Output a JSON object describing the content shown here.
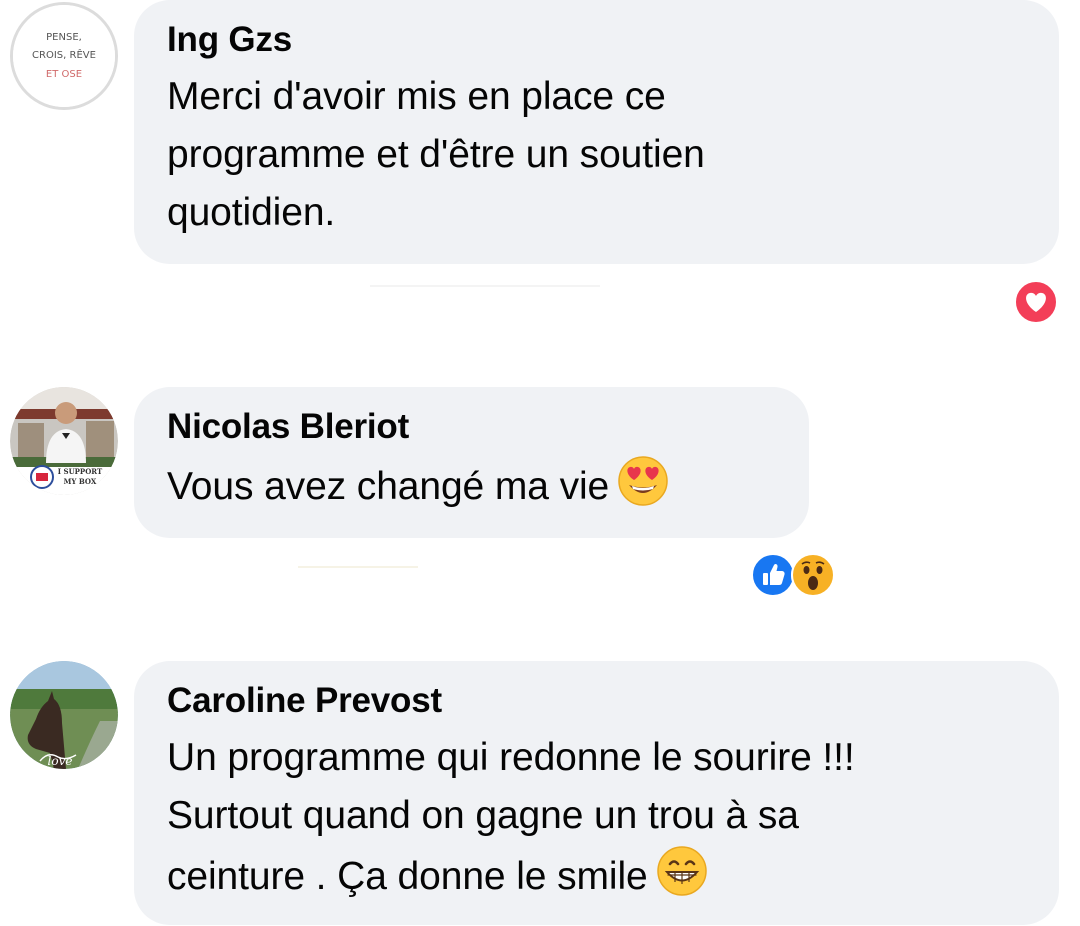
{
  "comments": [
    {
      "author": "Ing Gzs",
      "text_lines": [
        "Merci d'avoir mis en place ce",
        "programme et d'être un soutien",
        "quotidien."
      ],
      "avatar_text": [
        "PENSE,",
        "CROIS, RÊVE",
        "ET OSE"
      ],
      "reactions": [
        "heart-icon"
      ]
    },
    {
      "author": "Nicolas Bleriot",
      "text_lines": [
        "Vous avez changé ma vie"
      ],
      "emoji": "heart-eyes-emoji-icon",
      "avatar_badge_text": [
        "I SUPPORT",
        "MY BOX"
      ],
      "reactions": [
        "like-icon",
        "wow-icon"
      ]
    },
    {
      "author": "Caroline Prevost",
      "text_lines": [
        "Un programme qui redonne le sourire !!!",
        "Surtout quand on gagne un trou à sa",
        "ceinture . Ça donne le smile"
      ],
      "emoji": "grin-emoji-icon",
      "avatar_script": "love",
      "reactions": []
    }
  ],
  "colors": {
    "bubble": "#f0f2f5",
    "like": "#1877f2",
    "love": "#f33e58",
    "wow": "#f7b125"
  }
}
